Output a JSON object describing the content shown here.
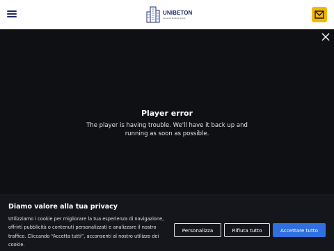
{
  "header": {
    "logo_text": "UNIBETON",
    "logo_subtitle": "Cementir Holding Group",
    "menu_icon": "hamburger-menu-icon",
    "contact_icon": "mail-icon",
    "contact_color": "#f5b800",
    "brand_color": "#1b2a6b"
  },
  "player": {
    "close_icon": "close-icon",
    "error_title": "Player error",
    "error_message": "The player is having trouble. We'll have it back up and running as soon as possible."
  },
  "cookie_banner": {
    "title": "Diamo valore alla tua privacy",
    "text": "Utilizziamo i cookie per migliorare la tua esperienza di navigazione, offrirti pubblicità o contenuti personalizzati e analizzare il nostro traffico. Cliccando “Accetta tutti”, acconsenti al nostro utilizzo dei cookie.",
    "customize_label": "Personalizza",
    "reject_label": "Rifiuta tutto",
    "accept_label": "Accettare tutto",
    "accept_color": "#2f6fe0"
  }
}
